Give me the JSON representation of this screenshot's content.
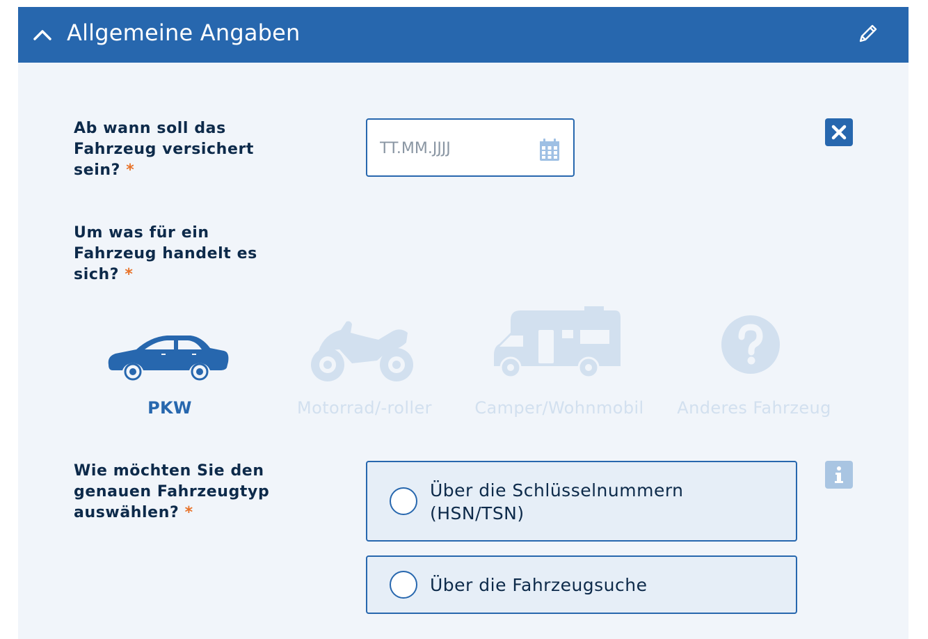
{
  "header": {
    "title": "Allgemeine Angaben",
    "collapse_icon": "chevron-up-icon",
    "edit_icon": "pencil-icon"
  },
  "colors": {
    "primary": "#2767ae",
    "required_star": "#e8732a",
    "inactive_vehicle": "#d2e0ef",
    "panel_bg": "#f1f5fa"
  },
  "insurance_start": {
    "question": "Ab wann soll das Fahrzeug versichert sein?",
    "required_marker": "*",
    "date_placeholder": "TT.MM.JJJJ",
    "date_value": "",
    "calendar_icon": "calendar-icon",
    "clear_icon": "close-icon"
  },
  "vehicle_type": {
    "question": "Um was für ein Fahrzeug handelt es sich?",
    "required_marker": "*",
    "selected": "PKW",
    "options": [
      {
        "label": "PKW",
        "icon": "car-icon"
      },
      {
        "label": "Motorrad/-roller",
        "icon": "motorcycle-icon"
      },
      {
        "label": "Camper/Wohnmobil",
        "icon": "camper-icon"
      },
      {
        "label": "Anderes Fahrzeug",
        "icon": "question-icon"
      }
    ]
  },
  "vehicle_lookup": {
    "question": "Wie möchten Sie den genauen Fahrzeugtyp auswählen?",
    "required_marker": "*",
    "info_icon": "info-icon",
    "options": [
      {
        "label": "Über die Schlüsselnummern (HSN/TSN)",
        "selected": false
      },
      {
        "label": "Über die Fahrzeugsuche",
        "selected": false
      }
    ]
  }
}
